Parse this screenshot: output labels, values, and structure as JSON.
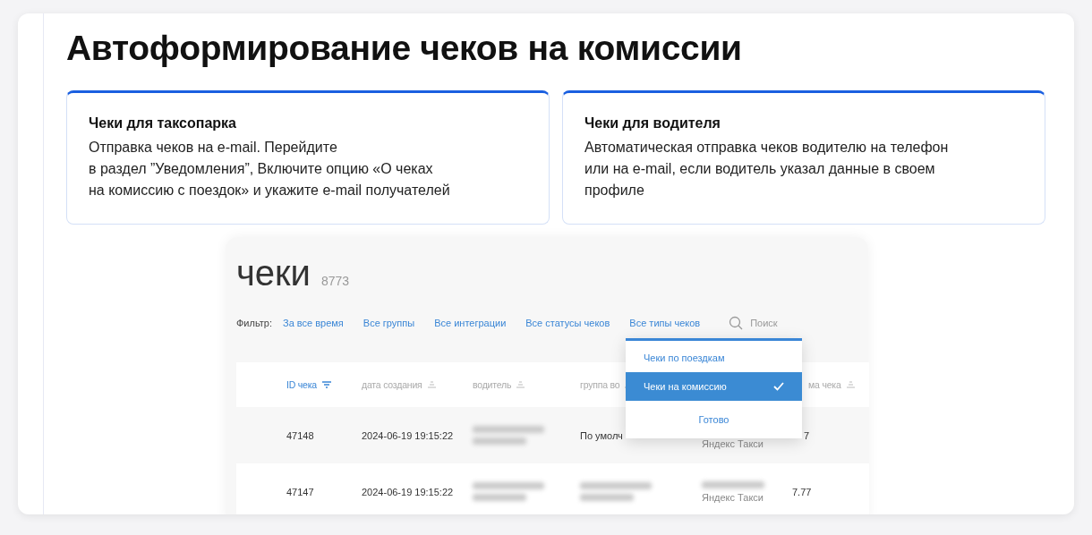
{
  "title": "Автоформирование чеков на комиссии",
  "cards": [
    {
      "title": "Чеки для таксопарка",
      "lines": [
        "Отправка чеков на e-mail. Перейдите",
        "в раздел ”Уведомления”, Включите опцию «О чеках",
        "на комиссию с поездок» и укажите e-mail получателей"
      ]
    },
    {
      "title": "Чеки для водителя",
      "lines": [
        "Автоматическая отправка чеков водителю на телефон",
        "или на e-mail, если водитель указал данные в своем",
        "профиле"
      ]
    }
  ],
  "screenshot": {
    "heading": "чеки",
    "count": "8773",
    "filter_label": "Фильтр:",
    "filters": [
      {
        "label": "За все время"
      },
      {
        "label": "Все группы"
      },
      {
        "label": "Все интеграции"
      },
      {
        "label": "Все статусы чеков"
      },
      {
        "label": "Все типы чеков"
      }
    ],
    "search": {
      "placeholder": "Поиск"
    },
    "dropdown": {
      "options": [
        {
          "label": "Чеки по поездкам",
          "selected": false
        },
        {
          "label": "Чеки на комиссию",
          "selected": true
        }
      ],
      "done": "Готово"
    },
    "table": {
      "columns": [
        {
          "label": "ID чека",
          "active": true
        },
        {
          "label": "дата создания",
          "active": false
        },
        {
          "label": "водитель",
          "active": false
        },
        {
          "label": "группа во",
          "active": false
        },
        {
          "label": "ма чека",
          "active": false
        }
      ],
      "rows": [
        {
          "id": "47148",
          "date": "2024-06-19 19:15:22",
          "driver": {
            "blurred": true
          },
          "group": {
            "text": "По умолч",
            "blurred": false
          },
          "org": {
            "blurred": false,
            "text": "Яндекс Такси"
          },
          "sum": {
            "text": "7",
            "covered": true
          }
        },
        {
          "id": "47147",
          "date": "2024-06-19 19:15:22",
          "driver": {
            "blurred": true
          },
          "group": {
            "blurred": true
          },
          "org": {
            "blurred": true,
            "text": "Яндекс Такси"
          },
          "sum": {
            "text": "7.77",
            "covered": false
          }
        }
      ]
    }
  }
}
